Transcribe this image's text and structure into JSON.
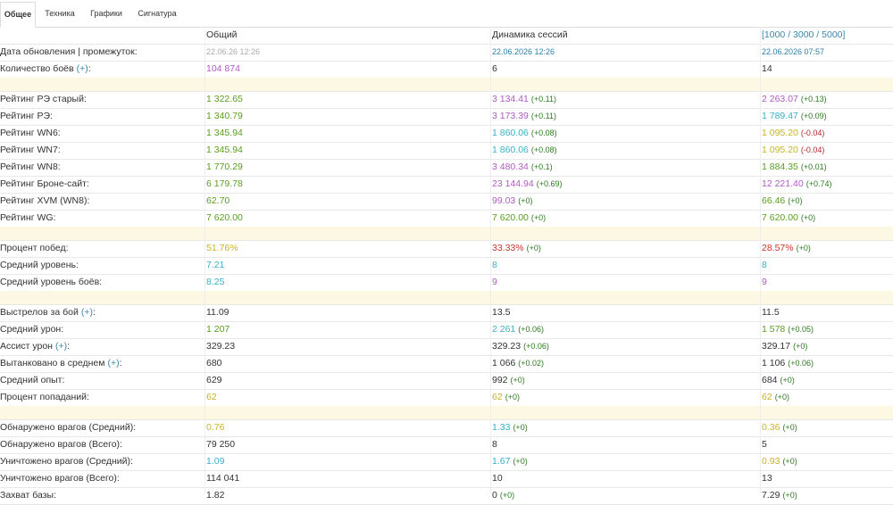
{
  "tabs": [
    "Общее",
    "Техника",
    "Графики",
    "Сигнатура"
  ],
  "columns": [
    "",
    "Общий",
    "Динамика сессий",
    "[1000 / 3000 / 5000]"
  ],
  "colors": {
    "green": "#5a9e1e",
    "purple": "#b25ac4",
    "cyan": "#36b2c9",
    "orange": "#c9b22a",
    "red": "#c9342e",
    "gray": "#aaa",
    "dark": "#333",
    "teal": "#2a7fa8",
    "dgreen": "#2d7a1f",
    "dred": "#b2292b"
  },
  "rows": [
    {
      "label": "Дата обновления | промежуток:",
      "cells": [
        {
          "v": "22.06.26 12:26",
          "c": "gray",
          "small": true
        },
        {
          "v": "22.06.2026 12:26",
          "c": "teal",
          "small": true
        },
        {
          "v": "22.06.2026 07:57",
          "c": "teal",
          "small": true
        }
      ]
    },
    {
      "label": "Количество боёв",
      "plus": "(+)",
      "label_end": ":",
      "cells": [
        {
          "v": "104 874",
          "c": "purple"
        },
        {
          "v": "6",
          "c": "dark"
        },
        {
          "v": "14",
          "c": "dark"
        }
      ]
    },
    {
      "sep": true
    },
    {
      "label": "Рейтинг РЭ старый:",
      "cells": [
        {
          "v": "1 322.65",
          "c": "green"
        },
        {
          "v": "3 134.41",
          "c": "purple",
          "d": "(+0.11)",
          "dc": "dgreen"
        },
        {
          "v": "2 263.07",
          "c": "purple",
          "d": "(+0.13)",
          "dc": "dgreen"
        }
      ]
    },
    {
      "label": "Рейтинг РЭ:",
      "cells": [
        {
          "v": "1 340.79",
          "c": "green"
        },
        {
          "v": "3 173.39",
          "c": "purple",
          "d": "(+0.11)",
          "dc": "dgreen"
        },
        {
          "v": "1 789.47",
          "c": "cyan",
          "d": "(+0.09)",
          "dc": "dgreen"
        }
      ]
    },
    {
      "label": "Рейтинг WN6:",
      "cells": [
        {
          "v": "1 345.94",
          "c": "green"
        },
        {
          "v": "1 860.06",
          "c": "cyan",
          "d": "(+0.08)",
          "dc": "dgreen"
        },
        {
          "v": "1 095.20",
          "c": "orange",
          "d": "(-0.04)",
          "dc": "dred"
        }
      ]
    },
    {
      "label": "Рейтинг WN7:",
      "cells": [
        {
          "v": "1 345.94",
          "c": "green"
        },
        {
          "v": "1 860.06",
          "c": "cyan",
          "d": "(+0.08)",
          "dc": "dgreen"
        },
        {
          "v": "1 095.20",
          "c": "orange",
          "d": "(-0.04)",
          "dc": "dred"
        }
      ]
    },
    {
      "label": "Рейтинг WN8:",
      "cells": [
        {
          "v": "1 770.29",
          "c": "green"
        },
        {
          "v": "3 480.34",
          "c": "purple",
          "d": "(+0.1)",
          "dc": "dgreen"
        },
        {
          "v": "1 884.35",
          "c": "green",
          "d": "(+0.01)",
          "dc": "dgreen"
        }
      ]
    },
    {
      "label": "Рейтинг Броне-сайт:",
      "cells": [
        {
          "v": "6 179.78",
          "c": "green"
        },
        {
          "v": "23 144.94",
          "c": "purple",
          "d": "(+0.69)",
          "dc": "dgreen"
        },
        {
          "v": "12 221.40",
          "c": "purple",
          "d": "(+0.74)",
          "dc": "dgreen"
        }
      ]
    },
    {
      "label": "Рейтинг XVM (WN8):",
      "cells": [
        {
          "v": "62.70",
          "c": "green"
        },
        {
          "v": "99.03",
          "c": "purple",
          "d": "(+0)",
          "dc": "dgreen"
        },
        {
          "v": "66.46",
          "c": "green",
          "d": "(+0)",
          "dc": "dgreen"
        }
      ]
    },
    {
      "label": "Рейтинг WG:",
      "cells": [
        {
          "v": "7 620.00",
          "c": "green"
        },
        {
          "v": "7 620.00",
          "c": "green",
          "d": "(+0)",
          "dc": "dgreen"
        },
        {
          "v": "7 620.00",
          "c": "green",
          "d": "(+0)",
          "dc": "dgreen"
        }
      ]
    },
    {
      "sep": true
    },
    {
      "label": "Процент побед:",
      "cells": [
        {
          "v": "51.76%",
          "c": "orange"
        },
        {
          "v": "33.33%",
          "c": "red",
          "d": "(+0)",
          "dc": "dgreen"
        },
        {
          "v": "28.57%",
          "c": "red",
          "d": "(+0)",
          "dc": "dgreen"
        }
      ]
    },
    {
      "label": "Средний уровень:",
      "cells": [
        {
          "v": "7.21",
          "c": "cyan"
        },
        {
          "v": "8",
          "c": "cyan"
        },
        {
          "v": "8",
          "c": "cyan"
        }
      ]
    },
    {
      "label": "Средний уровень боёв:",
      "cells": [
        {
          "v": "8.25",
          "c": "cyan"
        },
        {
          "v": "9",
          "c": "purple"
        },
        {
          "v": "9",
          "c": "purple"
        }
      ]
    },
    {
      "sep": true
    },
    {
      "label": "Выстрелов за бой",
      "plus": "(+)",
      "label_end": ":",
      "cells": [
        {
          "v": "11.09",
          "c": "dark"
        },
        {
          "v": "13.5",
          "c": "dark"
        },
        {
          "v": "11.5",
          "c": "dark"
        }
      ]
    },
    {
      "label": "Средний урон:",
      "cells": [
        {
          "v": "1 207",
          "c": "green"
        },
        {
          "v": "2 261",
          "c": "cyan",
          "d": "(+0.06)",
          "dc": "dgreen"
        },
        {
          "v": "1 578",
          "c": "green",
          "d": "(+0.05)",
          "dc": "dgreen"
        }
      ]
    },
    {
      "label": "Ассист урон",
      "plus": "(+)",
      "label_end": ":",
      "cells": [
        {
          "v": "329.23",
          "c": "dark"
        },
        {
          "v": "329.23",
          "c": "dark",
          "d": "(+0.06)",
          "dc": "dgreen"
        },
        {
          "v": "329.17",
          "c": "dark",
          "d": "(+0)",
          "dc": "dgreen"
        }
      ]
    },
    {
      "label": "Вытанковано в среднем",
      "plus": "(+)",
      "label_end": ":",
      "cells": [
        {
          "v": "680",
          "c": "dark"
        },
        {
          "v": "1 066",
          "c": "dark",
          "d": "(+0.02)",
          "dc": "dgreen"
        },
        {
          "v": "1 106",
          "c": "dark",
          "d": "(+0.06)",
          "dc": "dgreen"
        }
      ]
    },
    {
      "label": "Средний опыт:",
      "cells": [
        {
          "v": "629",
          "c": "dark"
        },
        {
          "v": "992",
          "c": "dark",
          "d": "(+0)",
          "dc": "dgreen"
        },
        {
          "v": "684",
          "c": "dark",
          "d": "(+0)",
          "dc": "dgreen"
        }
      ]
    },
    {
      "label": "Процент попаданий:",
      "cells": [
        {
          "v": "62",
          "c": "orange"
        },
        {
          "v": "62",
          "c": "orange",
          "d": "(+0)",
          "dc": "dgreen"
        },
        {
          "v": "62",
          "c": "orange",
          "d": "(+0)",
          "dc": "dgreen"
        }
      ]
    },
    {
      "sep": true
    },
    {
      "label": "Обнаружено врагов (Средний):",
      "cells": [
        {
          "v": "0.76",
          "c": "orange"
        },
        {
          "v": "1.33",
          "c": "cyan",
          "d": "(+0)",
          "dc": "dgreen"
        },
        {
          "v": "0.36",
          "c": "orange",
          "d": "(+0)",
          "dc": "dgreen"
        }
      ]
    },
    {
      "label": "Обнаружено врагов (Всего):",
      "cells": [
        {
          "v": "79 250",
          "c": "dark"
        },
        {
          "v": "8",
          "c": "dark"
        },
        {
          "v": "5",
          "c": "dark"
        }
      ]
    },
    {
      "label": "Уничтожено врагов (Средний):",
      "cells": [
        {
          "v": "1.09",
          "c": "cyan"
        },
        {
          "v": "1.67",
          "c": "cyan",
          "d": "(+0)",
          "dc": "dgreen"
        },
        {
          "v": "0.93",
          "c": "orange",
          "d": "(+0)",
          "dc": "dgreen"
        }
      ]
    },
    {
      "label": "Уничтожено врагов (Всего):",
      "cells": [
        {
          "v": "114 041",
          "c": "dark"
        },
        {
          "v": "10",
          "c": "dark"
        },
        {
          "v": "13",
          "c": "dark"
        }
      ]
    },
    {
      "label": "Захват базы:",
      "cells": [
        {
          "v": "1.82",
          "c": "dark"
        },
        {
          "v": "0",
          "c": "dark",
          "d": "(+0)",
          "dc": "dgreen"
        },
        {
          "v": "7.29",
          "c": "dark",
          "d": "(+0)",
          "dc": "dgreen"
        }
      ]
    }
  ]
}
